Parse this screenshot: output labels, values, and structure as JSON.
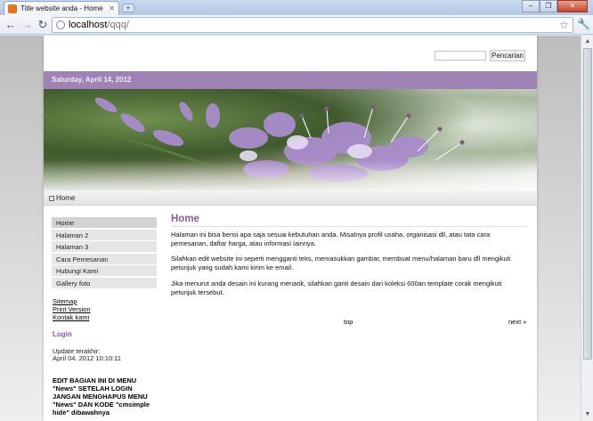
{
  "browser": {
    "tab_title": "Title website anda - Home",
    "tab_close": "✕",
    "new_tab": "+",
    "window_min": "–",
    "window_max": "❐",
    "window_close": "✕",
    "url_host": "localhost",
    "url_path": "/qqq/",
    "icons": [
      "back-icon",
      "forward-icon",
      "reload-icon",
      "globe-icon",
      "star-icon",
      "wrench-icon"
    ]
  },
  "header": {
    "search_placeholder": "",
    "search_button": "Pencarian",
    "date": "Saturday, April 14, 2012"
  },
  "breadcrumb": {
    "current": "Home"
  },
  "sidebar": {
    "menu": [
      {
        "label": "Home",
        "active": true
      },
      {
        "label": "Halaman 2",
        "active": false
      },
      {
        "label": "Halaman 3",
        "active": false
      },
      {
        "label": "Cara Pemesanan",
        "active": false
      },
      {
        "label": "Hubungi Kami",
        "active": false
      },
      {
        "label": "Gallery foto",
        "active": false
      }
    ],
    "links": [
      "Sitemap",
      "Print Version",
      "Kontak kami"
    ],
    "login_heading": "Login",
    "update_label": "Update terakhir:",
    "update_value": "April 04. 2012 10:10:11",
    "notice": "EDIT BAGIAN INI DI MENU \"News\" SETELAH LOGIN JANGAN MENGHAPUS MENU \"News\" DAN KODE \"cmsimple hide\" dibawahnya"
  },
  "main": {
    "title": "Home",
    "paragraphs": [
      "Halaman ini bisa berisi apa saja sesuai kebutuhan anda. Misalnya profil usaha, organisasi dll, atau tata cara pemesanan, daftar harga, atau informasi lainnya.",
      "Silahkan edit website ini seperti mengganti teks, memasukkan gambar, membuat menu/halaman baru dll mengikuti petunjuk yang sudah kami kirim ke email.",
      "Jika menurut anda desain ini kurang menarik, silahkan ganti desain dari koleksi 600an template corak mengikuti petunjuk tersebut."
    ],
    "top_link": "top",
    "next_link": "next »"
  },
  "colors": {
    "accent": "#8b59a8",
    "datebar": "#9f83b4"
  }
}
